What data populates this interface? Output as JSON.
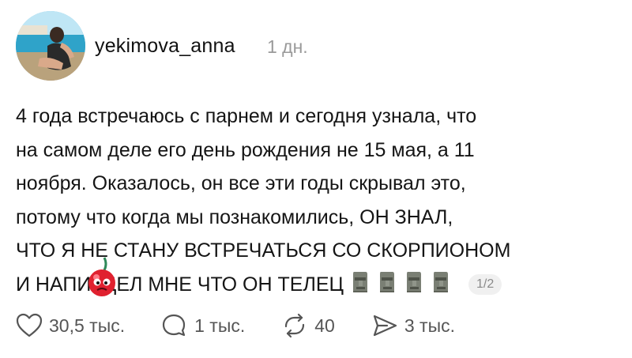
{
  "post": {
    "username": "yekimova_anna",
    "time": "1 дн.",
    "text_lines": [
      "4 года встречаюсь с парнем и сегодня узнала, что",
      "на самом деле его день рождения не 15 мая, а 11",
      "ноября. Оказалось, он все эти годы скрывал это,",
      "потому что когда мы познакомились, ОН ЗНАЛ,",
      "ЧТО Я НЕ СТАНУ ВСТРЕЧАТЬСЯ СО СКОРПИОНОМ",
      "И НАПИЗДЕЛ МНЕ ЧТО ОН ТЕЛЕЦ"
    ],
    "pager": "1/2",
    "icons": {
      "moai": "moai-emoji-icon",
      "sticker": "cherry-sticker-icon"
    }
  },
  "actions": {
    "likes": "30,5 тыс.",
    "comments": "1 тыс.",
    "reposts": "40",
    "shares": "3 тыс."
  }
}
